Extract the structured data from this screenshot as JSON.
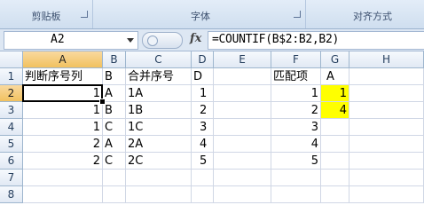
{
  "ribbon": {
    "groups": [
      {
        "label": "剪贴板",
        "has_launcher": true
      },
      {
        "label": "字体",
        "has_launcher": true
      },
      {
        "label": "对齐方式",
        "has_launcher": false
      }
    ]
  },
  "formula_bar": {
    "name_box": "A2",
    "fx_icon": "fx-icon",
    "formula": "=COUNTIF(B$2:B2,B2)"
  },
  "columns": [
    "A",
    "B",
    "C",
    "D",
    "E",
    "F",
    "G",
    "H"
  ],
  "rows": [
    {
      "num": "1",
      "cells": {
        "A": "判断序号列",
        "B": "B",
        "C": "合并序号",
        "D": "D",
        "E": "",
        "F": "匹配项",
        "G": "A",
        "H": ""
      }
    },
    {
      "num": "2",
      "cells": {
        "A": "1",
        "B": "A",
        "C": "1A",
        "D": "1",
        "E": "",
        "F": "1",
        "G": "1",
        "H": ""
      }
    },
    {
      "num": "3",
      "cells": {
        "A": "1",
        "B": "B",
        "C": "1B",
        "D": "2",
        "E": "",
        "F": "2",
        "G": "4",
        "H": ""
      }
    },
    {
      "num": "4",
      "cells": {
        "A": "1",
        "B": "C",
        "C": "1C",
        "D": "3",
        "E": "",
        "F": "3",
        "G": "",
        "H": ""
      }
    },
    {
      "num": "5",
      "cells": {
        "A": "2",
        "B": "A",
        "C": "2A",
        "D": "4",
        "E": "",
        "F": "4",
        "G": "",
        "H": ""
      }
    },
    {
      "num": "6",
      "cells": {
        "A": "2",
        "B": "C",
        "C": "2C",
        "D": "5",
        "E": "",
        "F": "5",
        "G": "",
        "H": ""
      }
    },
    {
      "num": "7",
      "cells": {
        "A": "",
        "B": "",
        "C": "",
        "D": "",
        "E": "",
        "F": "",
        "G": "",
        "H": ""
      }
    },
    {
      "num": "8",
      "cells": {
        "A": "",
        "B": "",
        "C": "",
        "D": "",
        "E": "",
        "F": "",
        "G": "",
        "H": ""
      }
    }
  ],
  "active_cell": "A2",
  "highlight_color": "#ffff00",
  "highlight_cells": [
    "G2",
    "G3"
  ]
}
